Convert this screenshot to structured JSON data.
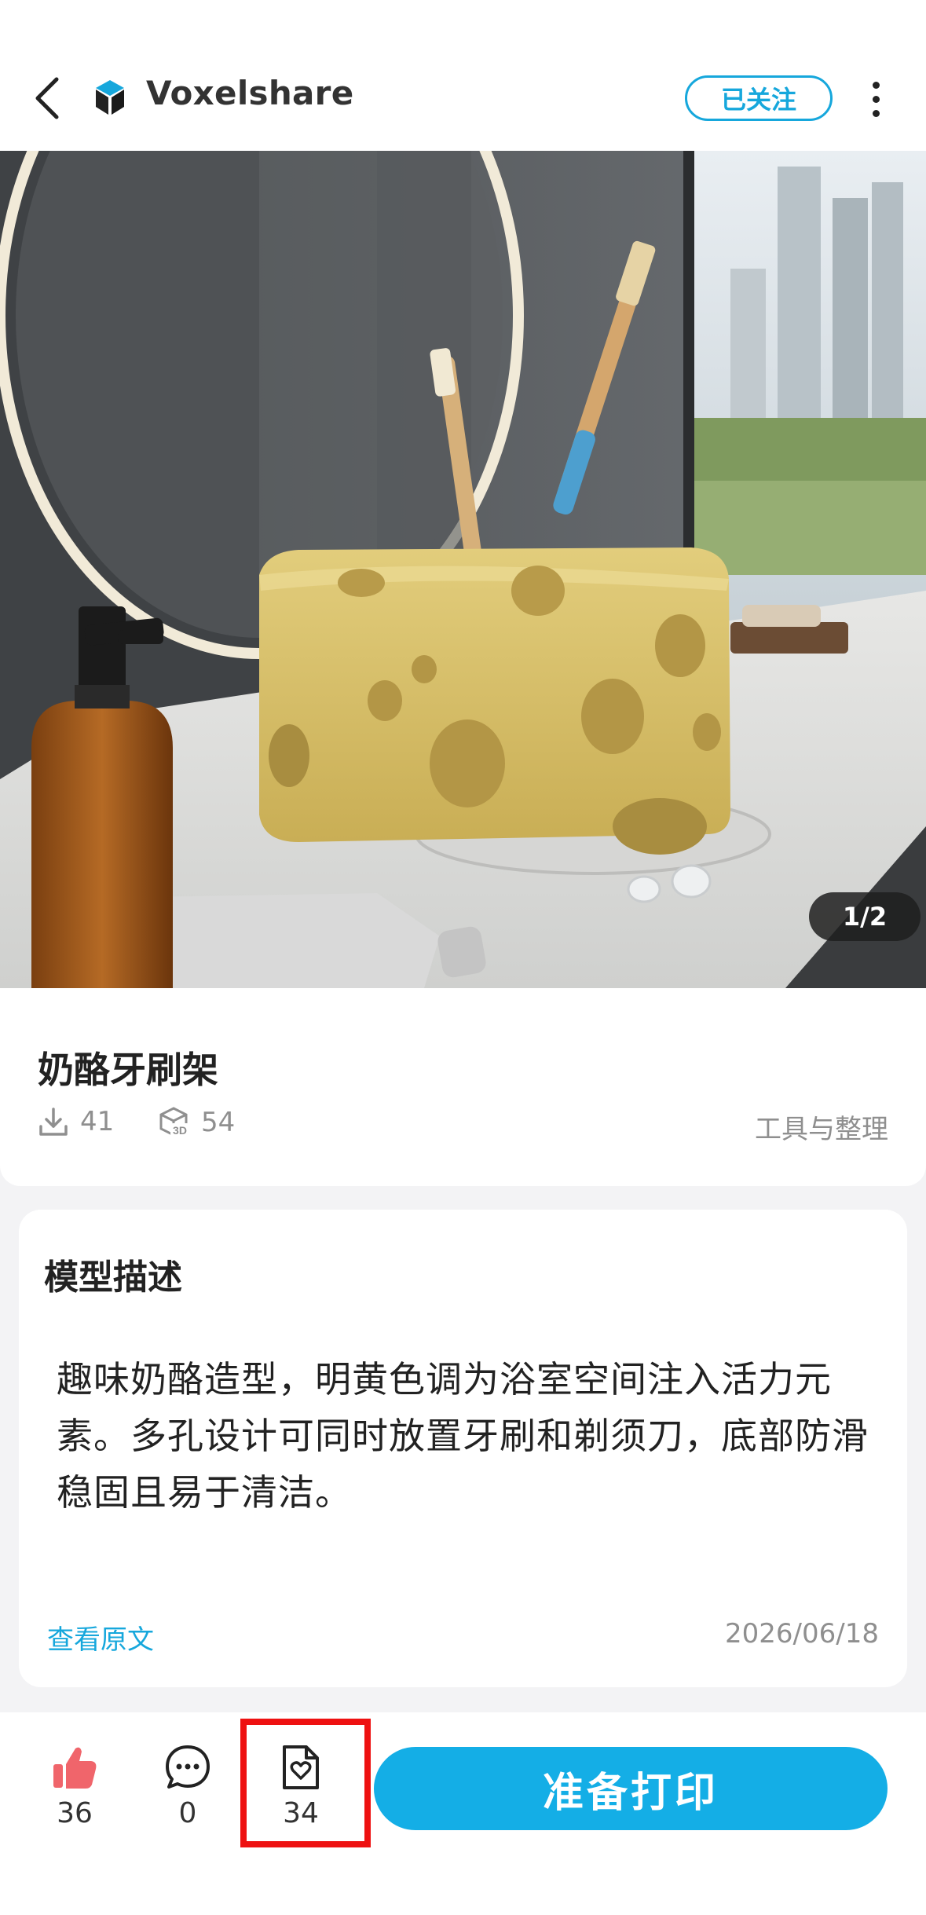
{
  "header": {
    "brand": "Voxelshare",
    "follow_label": "已关注",
    "icons": {
      "back": "chevron-left-icon",
      "logo": "voxelshare-logo",
      "more": "more-vertical-icon"
    }
  },
  "hero": {
    "page_indicator": "1/2"
  },
  "model": {
    "title": "奶酪牙刷架",
    "downloads": "41",
    "views_3d": "54",
    "category": "工具与整理"
  },
  "description": {
    "heading": "模型描述",
    "body": "趣味奶酪造型，明黄色调为浴室空间注入活力元素。多孔设计可同时放置牙刷和剃须刀，底部防滑稳固且易于清洁。",
    "view_original": "查看原文",
    "date": "2026/06/18"
  },
  "actions": {
    "likes": "36",
    "comments": "0",
    "collects": "34",
    "print_label": "准备打印"
  },
  "colors": {
    "accent": "#16a7dc",
    "print_button": "#14aee6",
    "like_icon": "#f0656b",
    "highlight": "#ee1111"
  }
}
